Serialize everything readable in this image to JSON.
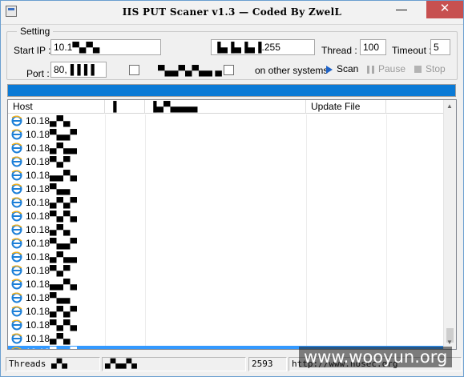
{
  "window": {
    "title": "IIS PUT Scaner v1.3 — Coded By ZwelL",
    "close_glyph": "✕",
    "max_glyph": "□",
    "min_glyph": "—"
  },
  "settings": {
    "group_label": "Setting",
    "start_ip_label": "Start IP :",
    "start_ip_value": "10.1▀▄▀▄",
    "end_ip_value": "▐▄▐▄▐▄▐.255",
    "thread_label": "Thread :",
    "thread_value": "100",
    "timeout_label": "Timeout :",
    "timeout_value": "5",
    "port_label": "Port :",
    "port_value": "80,▐▐▐▐",
    "option1_label": "▀▄▄▀▄▀▄▄ ▄",
    "option2_suffix": "on other systems",
    "scan_label": "Scan",
    "pause_label": "Pause",
    "stop_label": "Stop"
  },
  "progress": {
    "percent": 100
  },
  "table": {
    "columns": [
      "Host",
      "▐",
      "▐▄▀▄▄▄▄",
      "Update File"
    ],
    "rows": [
      "10.18▄▀▄",
      "10.18▀▄▄▀",
      "10.18▄▀▄▄",
      "10.18▀▄▀",
      "10.18▄▄▀▄",
      "10.18▀▄▄",
      "10.18▄▀▄▀",
      "10.18▀▄▀▄",
      "10.18▄▀▄",
      "10.18▀▄▄▀",
      "10.18▄▀▄▄",
      "10.18▀▄▀",
      "10.18▄▄▀▄",
      "10.18▀▄▄",
      "10.18▄▀▄▀",
      "10.18▀▄▀▄",
      "10.18▄▀▄",
      "10.18▀▄▄▀"
    ],
    "selected_index": 17
  },
  "status": {
    "threads_label": "Threads",
    "threads_value": "▄▀▄",
    "message": "▄▀▄▄▀▄",
    "count": "2593",
    "url": "http://www.nosec.org"
  },
  "watermark": "www.wooyun.org"
}
